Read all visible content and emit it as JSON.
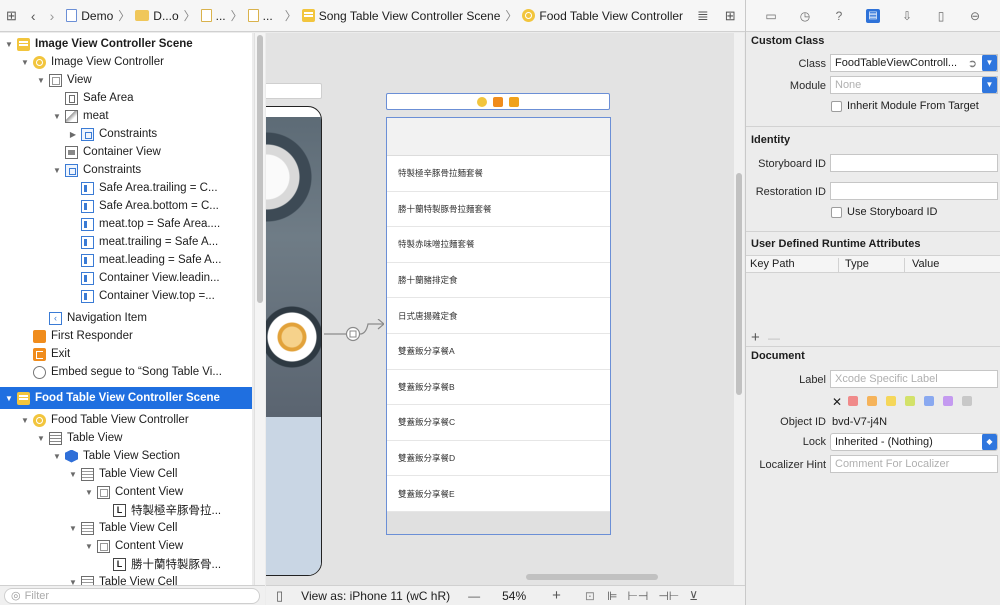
{
  "jumpbar": {
    "crumbs": [
      "Demo",
      "D...o",
      "...",
      "...",
      "Song Table View Controller Scene",
      "Food Table View Controller"
    ]
  },
  "outline": {
    "rows": [
      {
        "label": "Image View Controller Scene"
      },
      {
        "label": "Image View Controller"
      },
      {
        "label": "View"
      },
      {
        "label": "Safe Area"
      },
      {
        "label": "meat"
      },
      {
        "label": "Constraints"
      },
      {
        "label": "Container View"
      },
      {
        "label": "Constraints"
      },
      {
        "label": "Safe Area.trailing = C..."
      },
      {
        "label": "Safe Area.bottom = C..."
      },
      {
        "label": "meat.top = Safe Area...."
      },
      {
        "label": "meat.trailing = Safe A..."
      },
      {
        "label": "meat.leading = Safe A..."
      },
      {
        "label": "Container View.leadin..."
      },
      {
        "label": "Container View.top =..."
      },
      {
        "label": "Navigation Item"
      },
      {
        "label": "First Responder"
      },
      {
        "label": "Exit"
      },
      {
        "label": "Embed segue to “Song Table Vi..."
      },
      {
        "label": "Food Table View Controller Scene"
      },
      {
        "label": "Food Table View Controller"
      },
      {
        "label": "Table View"
      },
      {
        "label": "Table View Section"
      },
      {
        "label": "Table View Cell"
      },
      {
        "label": "Content View"
      },
      {
        "label": "特製極辛豚骨拉..."
      },
      {
        "label": "Table View Cell"
      },
      {
        "label": "Content View"
      },
      {
        "label": "勝十蘭特製豚骨..."
      },
      {
        "label": "Table View Cell"
      }
    ],
    "filter_placeholder": "Filter"
  },
  "canvas": {
    "cells": [
      "特製極辛豚骨拉麵套餐",
      "勝十蘭特製豚骨拉麵套餐",
      "特製赤味噌拉麵套餐",
      "勝十蘭豬排定食",
      "日式唐揚雞定食",
      "雙蓋飯分享餐A",
      "雙蓋飯分享餐B",
      "雙蓋飯分享餐C",
      "雙蓋飯分享餐D",
      "雙蓋飯分享餐E"
    ],
    "title_icon_colors": [
      "#f2c53d",
      "#f08c1c",
      "#f0a21c"
    ]
  },
  "bottombar": {
    "view_as": "View as: iPhone 11 (wC hR)",
    "zoom": "54%"
  },
  "inspector": {
    "custom_class": {
      "heading": "Custom Class",
      "class_label": "Class",
      "class_value": "FoodTableViewControll...",
      "module_label": "Module",
      "module_placeholder": "None",
      "inherit_label": "Inherit Module From Target"
    },
    "identity": {
      "heading": "Identity",
      "storyboard_id_label": "Storyboard ID",
      "restoration_id_label": "Restoration ID",
      "use_storyboard_id_label": "Use Storyboard ID"
    },
    "runtime": {
      "heading": "User Defined Runtime Attributes",
      "col_key": "Key Path",
      "col_type": "Type",
      "col_value": "Value"
    },
    "document": {
      "heading": "Document",
      "label_label": "Label",
      "label_placeholder": "Xcode Specific Label",
      "object_id_label": "Object ID",
      "object_id_value": "bvd-V7-j4N",
      "lock_label": "Lock",
      "lock_value": "Inherited - (Nothing)",
      "hint_label": "Localizer Hint",
      "hint_placeholder": "Comment For Localizer",
      "swatch_colors": [
        "#f08a8a",
        "#f5b35a",
        "#f5d75a",
        "#d3e26a",
        "#8aa9f0",
        "#c49af0",
        "#c8c8c8"
      ]
    }
  }
}
